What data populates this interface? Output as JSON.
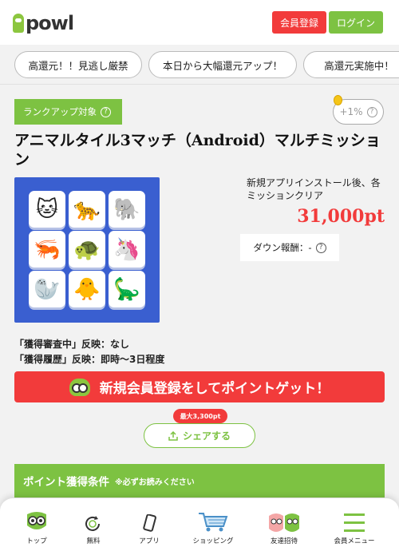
{
  "header": {
    "logo_text": "powl",
    "register_label": "会員登録",
    "login_label": "ログイン"
  },
  "campaign_tabs": [
    {
      "label": "高還元！！見逃し厳禁"
    },
    {
      "label": "本日から大幅還元アップ！"
    },
    {
      "label": "高還元実施中！"
    }
  ],
  "offer": {
    "rank_badge": "ランクアップ対象",
    "bonus_percent": "+1%",
    "title": "アニマルタイル3マッチ（Android）マルチミッション",
    "condition_text": "新規アプリインストール後、各ミッションクリア",
    "points": "31,000pt",
    "down_reward": "ダウン報酬：-",
    "review_status": "「獲得審査中」反映：なし",
    "review_history": "「獲得履歴」反映：即時～3日程度",
    "app_tiles": [
      "🐱",
      "🐆",
      "🐘",
      "🦐",
      "🐢",
      "🦄",
      "🦭",
      "🐥",
      "🦕"
    ]
  },
  "cta": {
    "label": "新規会員登録をしてポイントゲット！"
  },
  "share": {
    "max_label": "最大3,300pt",
    "button_label": "シェアする"
  },
  "conditions": {
    "title": "ポイント獲得条件",
    "note": "※必ずお読みください"
  },
  "bottom_nav": [
    {
      "label": "トップ",
      "icon": "owl-icon"
    },
    {
      "label": "無料",
      "icon": "free-icon"
    },
    {
      "label": "アプリ",
      "icon": "smartphone-icon"
    },
    {
      "label": "ショッピング",
      "icon": "cart-icon"
    },
    {
      "label": "友達招待",
      "icon": "friends-icon"
    },
    {
      "label": "会員メニュー",
      "icon": "menu-icon"
    }
  ],
  "colors": {
    "brand_green": "#7dc242",
    "accent_red": "#f23b3b",
    "app_icon_blue": "#3a5fd0"
  }
}
